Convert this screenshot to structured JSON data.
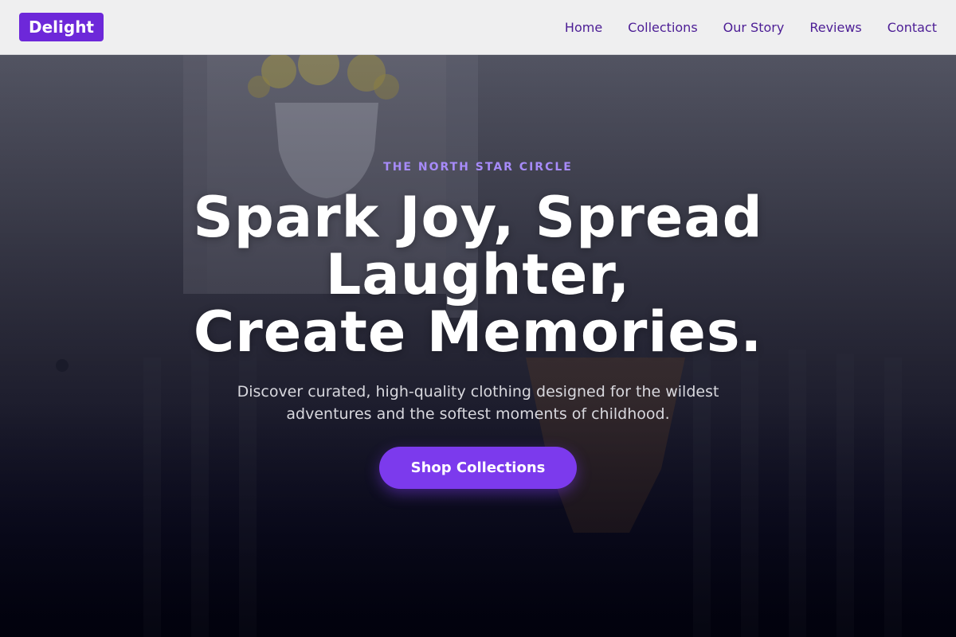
{
  "brand": {
    "logo_text": "Delight"
  },
  "nav": {
    "items": [
      {
        "label": "Home"
      },
      {
        "label": "Collections"
      },
      {
        "label": "Our Story"
      },
      {
        "label": "Reviews"
      },
      {
        "label": "Contact"
      }
    ]
  },
  "hero": {
    "eyebrow": "THE NORTH STAR CIRCLE",
    "headline": [
      "Spark Joy, Spread",
      "Laughter,",
      "Create Memories."
    ],
    "subtext": "Discover curated, high-quality clothing designed for the wildest adventures and the softest moments of childhood.",
    "cta_label": "Shop Collections"
  },
  "colors": {
    "accent": "#7c3aed",
    "logo_bg": "#6d28d9",
    "eyebrow": "#a78bfa",
    "nav_text": "#4c1d95",
    "header_bg": "#efeff0"
  }
}
